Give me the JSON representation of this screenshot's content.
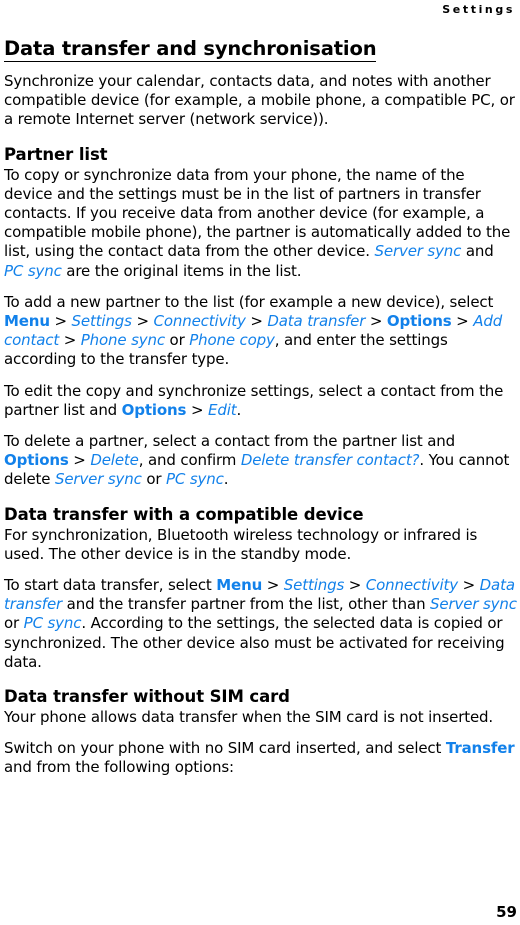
{
  "page": {
    "running_head": "Settings",
    "folio": "59",
    "accent_color": "#1281ea",
    "text_color": "#000000",
    "background_color": "#ffffff"
  },
  "headings": {
    "h1": "Data transfer and synchronisation",
    "partner_list": "Partner list",
    "compatible_device": "Data transfer with a compatible device",
    "without_sim": "Data transfer without SIM card"
  },
  "intro": {
    "paragraph": "Synchronize your calendar, contacts data, and notes with another compatible device (for example, a mobile phone, a compatible PC, or a remote Internet server (network service))."
  },
  "partner_list": {
    "p1_a": "To copy or synchronize data from your phone, the name of the device and the settings must be in the list of partners in transfer contacts. If you receive data from another device (for example, a compatible mobile phone), the partner is automatically added to the list, using the contact data from the other device. ",
    "p1_ui1": "Server sync",
    "p1_b": " and ",
    "p1_ui2": "PC sync",
    "p1_c": " are the original items in the list.",
    "p2_a": "To add a new partner to the list (for example a new device), select ",
    "p2_ui1": "Menu",
    "p2_s1": " > ",
    "p2_ui2": "Settings",
    "p2_s2": " > ",
    "p2_ui3": "Connectivity",
    "p2_s3": " > ",
    "p2_ui4": "Data transfer",
    "p2_s4": " > ",
    "p2_ui5": "Options",
    "p2_s5": " > ",
    "p2_ui6": "Add contact",
    "p2_s6": " > ",
    "p2_ui7": "Phone sync",
    "p2_b": " or ",
    "p2_ui8": "Phone copy",
    "p2_c": ", and enter the settings according to the transfer type.",
    "p3_a": "To edit the copy and synchronize settings, select a contact from the partner list and ",
    "p3_ui1": "Options",
    "p3_s1": " > ",
    "p3_ui2": "Edit",
    "p3_b": ".",
    "p4_a": "To delete a partner, select a contact from the partner list and ",
    "p4_ui1": "Options",
    "p4_s1": " > ",
    "p4_ui2": "Delete",
    "p4_b": ", and confirm ",
    "p4_ui3": "Delete transfer contact?",
    "p4_c": ". You cannot delete ",
    "p4_ui4": "Server sync",
    "p4_d": " or ",
    "p4_ui5": "PC sync",
    "p4_e": "."
  },
  "compatible_device": {
    "p1": "For synchronization, Bluetooth wireless technology or infrared is used. The other device is in the standby mode.",
    "p2_a": "To start data transfer, select ",
    "p2_ui1": "Menu",
    "p2_s1": " > ",
    "p2_ui2": "Settings",
    "p2_s2": " > ",
    "p2_ui3": "Connectivity",
    "p2_s3": " > ",
    "p2_ui4": "Data transfer",
    "p2_b": " and the transfer partner from the list, other than ",
    "p2_ui5": "Server sync",
    "p2_c": " or ",
    "p2_ui6": "PC sync",
    "p2_d": ". According to the settings, the selected data is copied or synchronized. The other device also must be activated for receiving data."
  },
  "without_sim": {
    "p1": "Your phone allows data transfer when the SIM card is not inserted.",
    "p2_a": "Switch on your phone with no SIM card inserted, and select ",
    "p2_ui1": "Transfer",
    "p2_b": " and from the following options:"
  }
}
